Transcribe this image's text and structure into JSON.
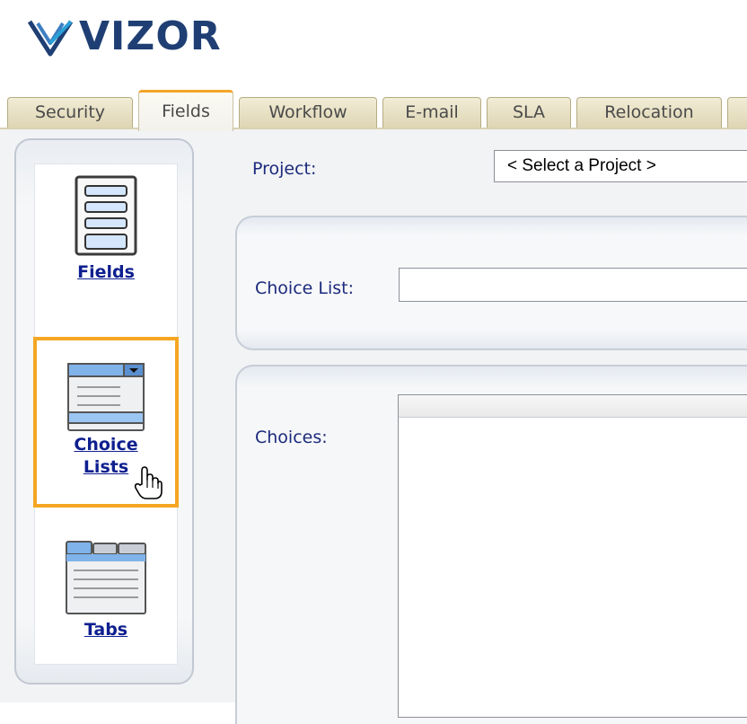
{
  "logo": {
    "text": "VIZOR"
  },
  "tabs": [
    {
      "label": "Security"
    },
    {
      "label": "Fields",
      "active": true
    },
    {
      "label": "Workflow"
    },
    {
      "label": "E-mail"
    },
    {
      "label": "SLA"
    },
    {
      "label": "Relocation"
    }
  ],
  "nav": {
    "items": [
      {
        "label": "Fields",
        "icon": "form-fields-icon"
      },
      {
        "label": "Choice Lists",
        "label_line1": "Choice",
        "label_line2": "Lists",
        "icon": "dropdown-list-icon",
        "selected": true
      },
      {
        "label": "Tabs",
        "icon": "tabs-icon"
      }
    ]
  },
  "form": {
    "project_label": "Project:",
    "project_value": "< Select a Project >",
    "choice_list_label": "Choice List:",
    "choice_list_value": "",
    "choices_label": "Choices:"
  },
  "colors": {
    "accent": "#f5a623",
    "link": "#0e1f8f",
    "label": "#1b2a7c",
    "logo": "#1f3f74"
  }
}
